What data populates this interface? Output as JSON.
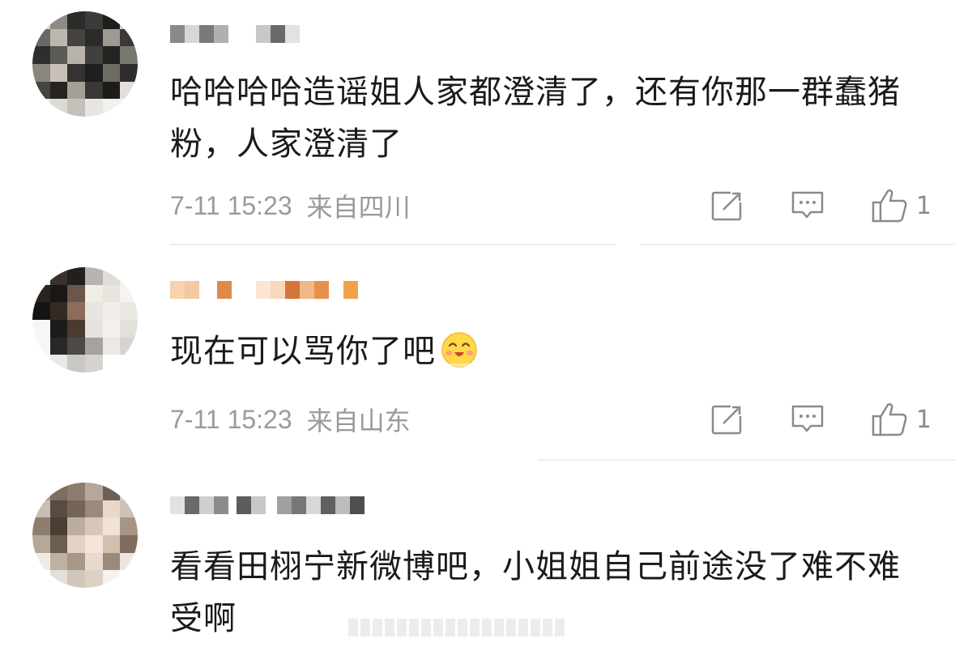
{
  "comments": [
    {
      "text": "哈哈哈哈造谣姐人家都澄清了，还有你那一群蠢猪粉，人家澄清了",
      "time": "7-11 15:23",
      "location": "来自四川",
      "like_count": "1"
    },
    {
      "text": "现在可以骂你了吧",
      "emoji": "happy-face-emoji",
      "time": "7-11 15:23",
      "location": "来自山东",
      "like_count": "1"
    },
    {
      "text": "看看田栩宁新微博吧，小姐姐自己前途没了难不难受啊"
    }
  ],
  "colors": {
    "text": "#1a1a1a",
    "meta": "#9a9a9a",
    "divider": "#eeeeee",
    "icon": "#8a8a8a"
  },
  "icons": {
    "share": "share-icon",
    "comment": "comment-icon",
    "like": "like-icon"
  }
}
